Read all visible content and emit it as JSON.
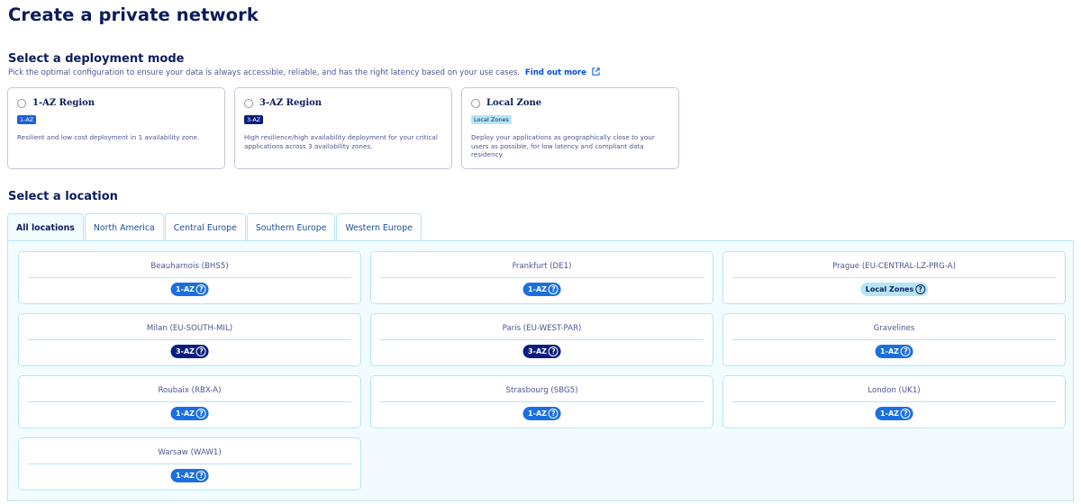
{
  "page": {
    "title": "Create a private network"
  },
  "deployment": {
    "title": "Select a deployment mode",
    "intro": "Pick the optimal configuration to ensure your data is always accessible, reliable, and has the right latency based on your use cases.",
    "link_label": "Find out more",
    "modes": [
      {
        "title": "1-AZ Region",
        "badge": "1-AZ",
        "desc": "Resilient and low cost deployment in 1 availability zone."
      },
      {
        "title": "3-AZ Region",
        "badge": "3-AZ",
        "desc": "High resilience/high availability deployment for your critical applications across 3 availability zones."
      },
      {
        "title": "Local Zone",
        "badge": "Local Zones",
        "desc": "Deploy your applications as geographically close to your users as possible, for low latency and compliant data residency."
      }
    ]
  },
  "location": {
    "title": "Select a location",
    "tabs": [
      "All locations",
      "North America",
      "Central Europe",
      "Southern Europe",
      "Western Europe"
    ],
    "cards": [
      {
        "name": "Beauharnois (BHS5)",
        "badge": "1-AZ"
      },
      {
        "name": "Frankfurt (DE1)",
        "badge": "1-AZ"
      },
      {
        "name": "Prague (EU-CENTRAL-LZ-PRG-A)",
        "badge": "Local Zones"
      },
      {
        "name": "Milan (EU-SOUTH-MIL)",
        "badge": "3-AZ"
      },
      {
        "name": "Paris (EU-WEST-PAR)",
        "badge": "3-AZ"
      },
      {
        "name": "Gravelines",
        "badge": "1-AZ"
      },
      {
        "name": "Roubaix (RBX-A)",
        "badge": "1-AZ"
      },
      {
        "name": "Strasbourg (SBG5)",
        "badge": "1-AZ"
      },
      {
        "name": "London (UK1)",
        "badge": "1-AZ"
      },
      {
        "name": "Warsaw (WAW1)",
        "badge": "1-AZ"
      }
    ]
  },
  "icons": {
    "external_link": "external-link-icon",
    "help": "question-circle-icon",
    "radio": "radio-button"
  },
  "colors": {
    "primary": "#0a1c5c",
    "link": "#0050d7",
    "badge_1az": "#1b6fe0",
    "badge_3az": "#0a1c7c",
    "badge_local": "#b6e5f7",
    "panel_bg": "#f2fcff"
  }
}
